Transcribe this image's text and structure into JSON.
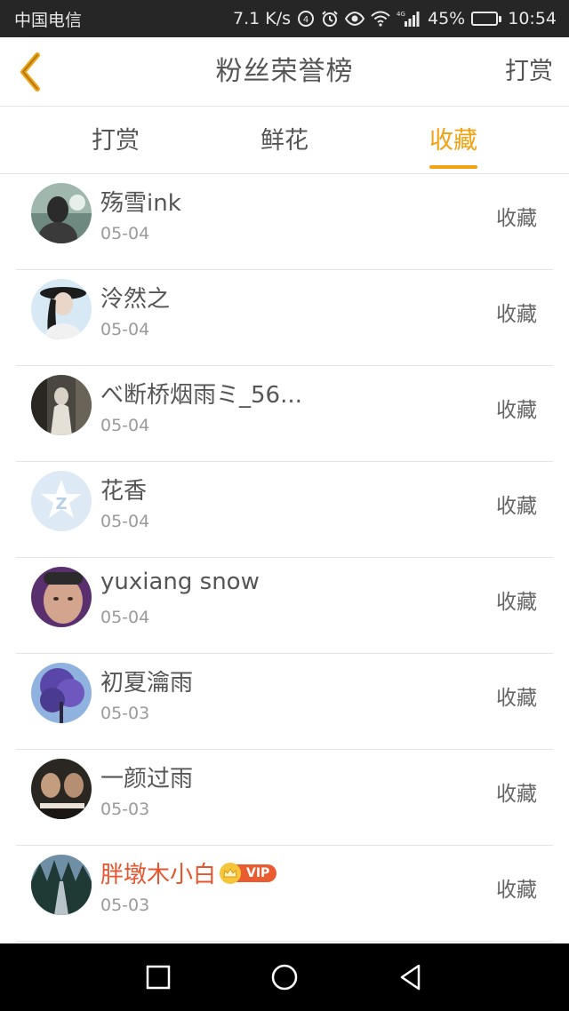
{
  "status_bar": {
    "carrier": "中国电信",
    "speed": "7.1 K/s",
    "network": "4G",
    "battery": "45%",
    "battery_level": 0.45,
    "time": "10:54"
  },
  "header": {
    "title": "粉丝荣誉榜",
    "action_label": "打赏"
  },
  "tabs": [
    {
      "label": "打赏",
      "active": false
    },
    {
      "label": "鲜花",
      "active": false
    },
    {
      "label": "收藏",
      "active": true
    }
  ],
  "accent_color": "#f0a212",
  "fans": [
    {
      "name": "殇雪ink",
      "date": "05-04",
      "action": "收藏",
      "vip": false
    },
    {
      "name": "泠然之",
      "date": "05-04",
      "action": "收藏",
      "vip": false
    },
    {
      "name": "べ断桥烟雨ミ_56...",
      "date": "05-04",
      "action": "收藏",
      "vip": false
    },
    {
      "name": "花香",
      "date": "05-04",
      "action": "收藏",
      "vip": false
    },
    {
      "name": "yuxiang snow",
      "date": "05-04",
      "action": "收藏",
      "vip": false
    },
    {
      "name": "初夏瀹雨",
      "date": "05-03",
      "action": "收藏",
      "vip": false
    },
    {
      "name": "一颜过雨",
      "date": "05-03",
      "action": "收藏",
      "vip": false
    },
    {
      "name": "胖墩木小白",
      "date": "05-03",
      "action": "收藏",
      "vip": true,
      "vip_label": "VIP"
    }
  ]
}
